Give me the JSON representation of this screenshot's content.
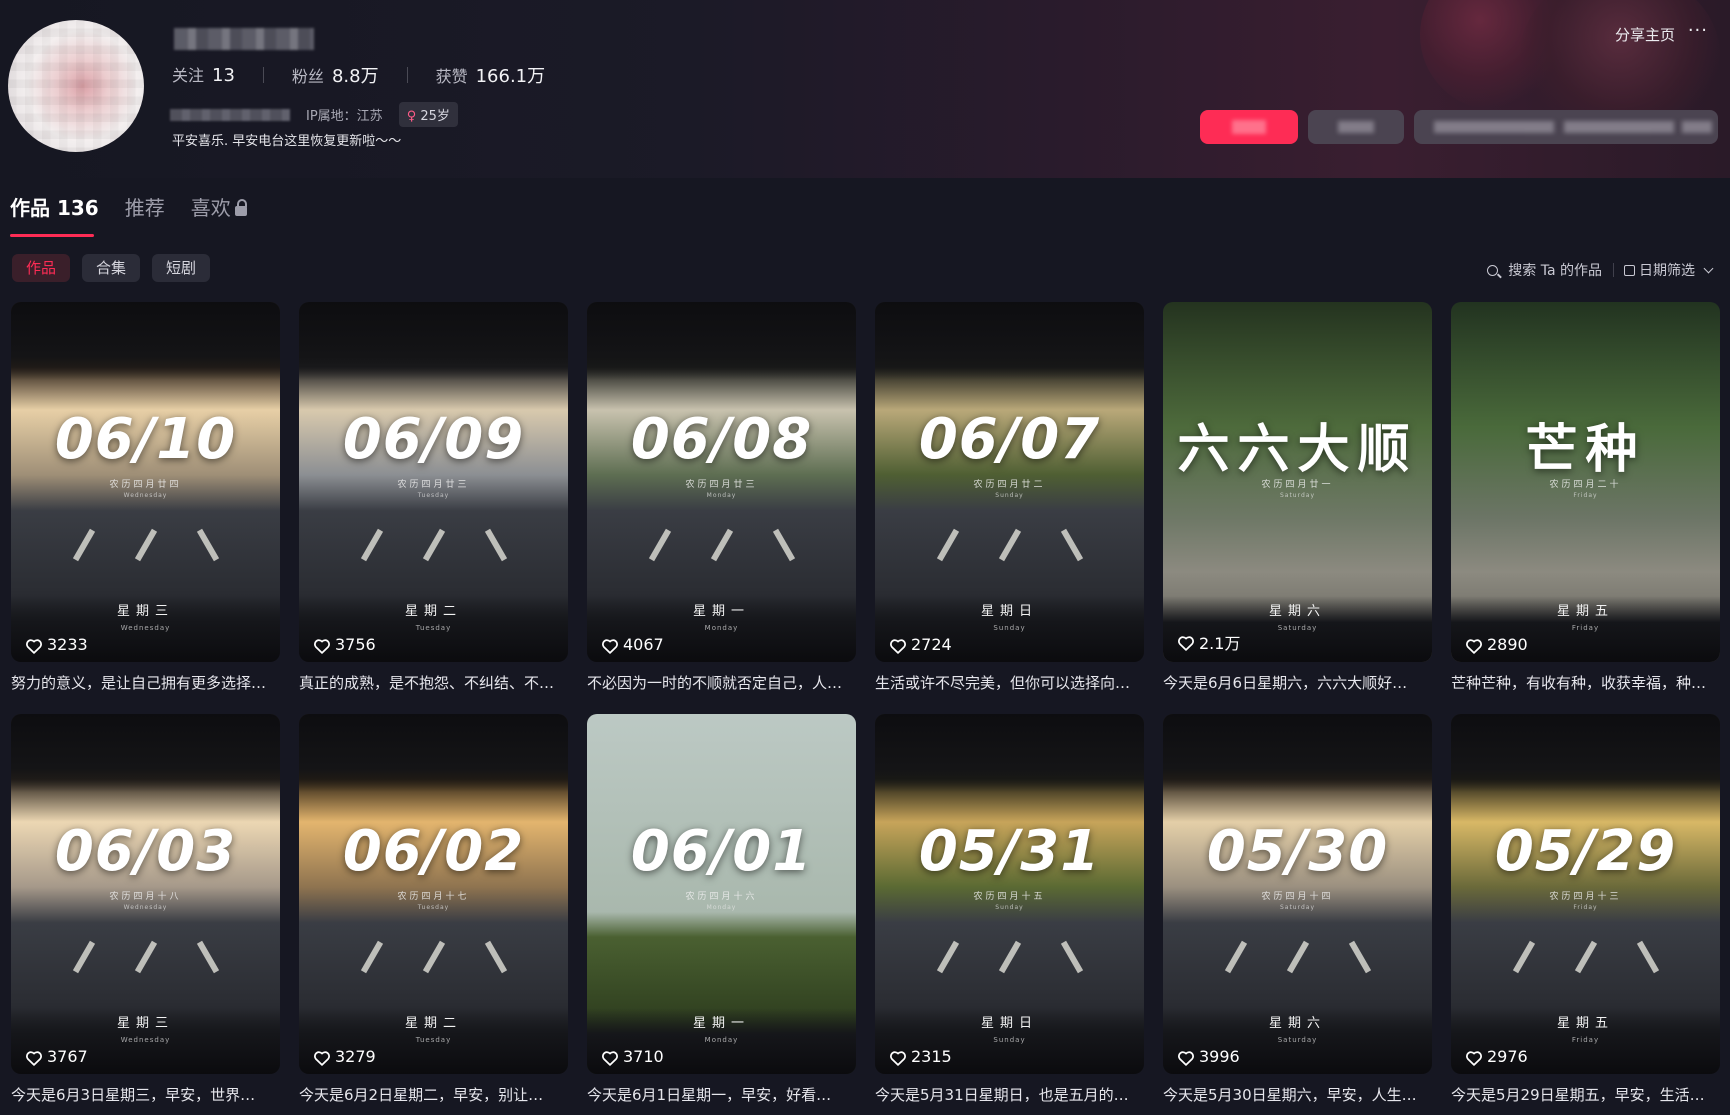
{
  "profile": {
    "stats": [
      {
        "label": "关注",
        "value": "13"
      },
      {
        "label": "粉丝",
        "value": "8.8万"
      },
      {
        "label": "获赞",
        "value": "166.1万"
      }
    ],
    "ip_location": "IP属地：江苏",
    "age_badge": "25岁",
    "bio": "平安喜乐. 早安电台这里恢复更新啦～～",
    "share_label": "分享主页",
    "more_label": "···"
  },
  "tabs": [
    {
      "label": "作品 136",
      "active": true
    },
    {
      "label": "推荐",
      "active": false
    },
    {
      "label": "喜欢",
      "active": false,
      "locked": true
    }
  ],
  "filters": [
    {
      "label": "作品",
      "active": true
    },
    {
      "label": "合集",
      "active": false
    },
    {
      "label": "短剧",
      "active": false
    }
  ],
  "toolbar": {
    "search_label": "搜索 Ta 的作品",
    "date_filter_label": "日期筛选"
  },
  "colors": {
    "accent": "#fe2c55",
    "background": "#161722"
  },
  "videos": [
    {
      "title": "06/10",
      "lunar": "农历四月廿四",
      "weekday": "星期三",
      "weekday_en": "Wednesday",
      "likes": "3233",
      "caption": "努力的意义，是让自己拥有更多选择…",
      "sky": [
        "#2c2118",
        "#e7cfa6",
        "#9f8f77"
      ],
      "style": "road"
    },
    {
      "title": "06/09",
      "lunar": "农历四月廿三",
      "weekday": "星期二",
      "weekday_en": "Tuesday",
      "likes": "3756",
      "caption": "真正的成熟，是不抱怨、不纠结、不…",
      "sky": [
        "#1e1e20",
        "#d8c9ad",
        "#8c8f93"
      ],
      "style": "road"
    },
    {
      "title": "06/08",
      "lunar": "农历四月廿三",
      "weekday": "星期一",
      "weekday_en": "Monday",
      "likes": "4067",
      "caption": "不必因为一时的不顺就否定自己，人…",
      "sky": [
        "#1c1d1a",
        "#c8c2ae",
        "#5e6e52"
      ],
      "style": "road"
    },
    {
      "title": "06/07",
      "lunar": "农历四月廿二",
      "weekday": "星期日",
      "weekday_en": "Sunday",
      "likes": "2724",
      "caption": "生活或许不尽完美，但你可以选择向…",
      "sky": [
        "#1a1b18",
        "#b9a879",
        "#4f5f33"
      ],
      "style": "road"
    },
    {
      "title": "六六大顺",
      "lunar": "农历四月廿一",
      "weekday": "星期六",
      "weekday_en": "Saturday",
      "likes": "2.1万",
      "caption": "今天是6月6日星期六，六六大顺好…",
      "sky": [
        "#24331f",
        "#4e6b3c",
        "#6e7866"
      ],
      "style": "trees"
    },
    {
      "title": "芒种",
      "lunar": "农历四月二十",
      "weekday": "星期五",
      "weekday_en": "Friday",
      "likes": "2890",
      "caption": "芒种芒种，有收有种，收获幸福，种…",
      "sky": [
        "#223320",
        "#4a6a3b",
        "#6c7566"
      ],
      "style": "trees"
    },
    {
      "title": "06/03",
      "lunar": "农历四月十八",
      "weekday": "星期三",
      "weekday_en": "Wednesday",
      "likes": "3767",
      "caption": "今天是6月3日星期三，早安，世界…",
      "sky": [
        "#2a221a",
        "#ecd7b3",
        "#a6998a"
      ],
      "style": "road"
    },
    {
      "title": "06/02",
      "lunar": "农历四月十七",
      "weekday": "星期二",
      "weekday_en": "Tuesday",
      "likes": "3279",
      "caption": "今天是6月2日星期二，早安，别让…",
      "sky": [
        "#2c2113",
        "#e3b56e",
        "#8f7450"
      ],
      "style": "road"
    },
    {
      "title": "06/01",
      "lunar": "农历四月十六",
      "weekday": "星期一",
      "weekday_en": "Monday",
      "likes": "3710",
      "caption": "今天是6月1日星期一，早安，好看…",
      "sky": [
        "#bcc9c4",
        "#a9b8ad",
        "#4a6031"
      ],
      "style": "field"
    },
    {
      "title": "05/31",
      "lunar": "农历四月十五",
      "weekday": "星期日",
      "weekday_en": "Sunday",
      "likes": "2315",
      "caption": "今天是5月31日星期日，也是五月的…",
      "sky": [
        "#1e1e14",
        "#c7a45a",
        "#5b6a33"
      ],
      "style": "road"
    },
    {
      "title": "05/30",
      "lunar": "农历四月十四",
      "weekday": "星期六",
      "weekday_en": "Saturday",
      "likes": "3996",
      "caption": "今天是5月30日星期六，早安，人生…",
      "sky": [
        "#2b2218",
        "#e4cfa8",
        "#9b9080"
      ],
      "style": "road"
    },
    {
      "title": "05/29",
      "lunar": "农历四月十三",
      "weekday": "星期五",
      "weekday_en": "Friday",
      "likes": "2976",
      "caption": "今天是5月29日星期五，早安，生活…",
      "sky": [
        "#1f1d13",
        "#d8b866",
        "#6b6a3a"
      ],
      "style": "road"
    }
  ]
}
